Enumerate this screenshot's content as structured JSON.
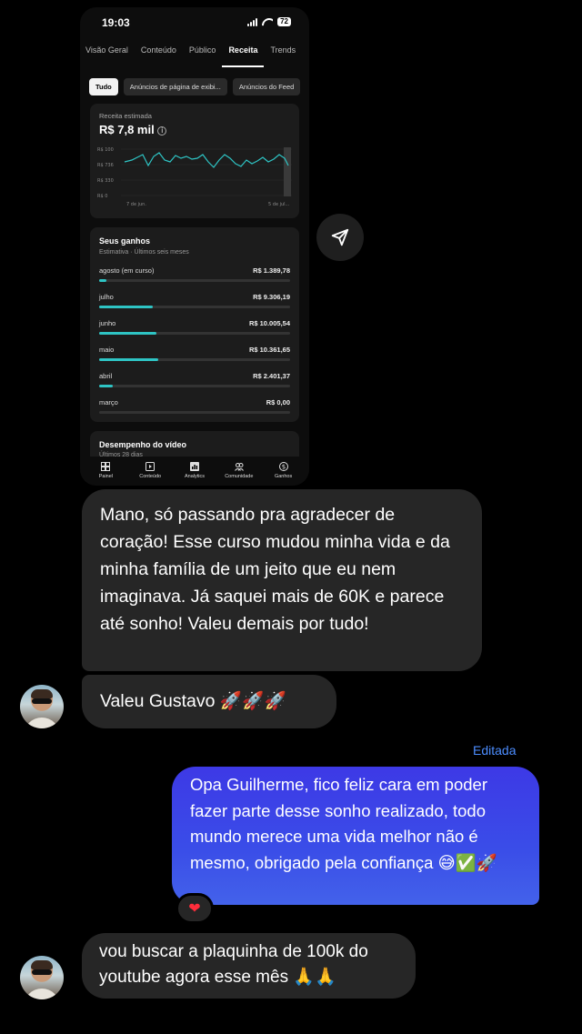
{
  "shared_screenshot": {
    "status_time": "19:03",
    "battery": "72",
    "tabs": [
      "Visão Geral",
      "Conteúdo",
      "Público",
      "Receita",
      "Trends"
    ],
    "active_tab": "Receita",
    "chips": [
      "Tudo",
      "Anúncios de página de exibi...",
      "Anúncios do Feed"
    ],
    "revenue_card": {
      "label": "Receita estimada",
      "value": "R$ 7,8 mil",
      "info_icon": "info-icon",
      "y_ticks": [
        "R$ 100",
        "R$ 736",
        "R$ 330",
        "R$ 0"
      ],
      "x_ticks": [
        "7 de jun.",
        "5 de jul..."
      ]
    },
    "earnings": {
      "title": "Seus ganhos",
      "subtitle": "Estimativa · Últimos seis meses",
      "rows": [
        {
          "month": "agosto (em curso)",
          "value": "R$ 1.389,78",
          "fraction": 0.04
        },
        {
          "month": "julho",
          "value": "R$ 9.306,19",
          "fraction": 0.28
        },
        {
          "month": "junho",
          "value": "R$ 10.005,54",
          "fraction": 0.3
        },
        {
          "month": "maio",
          "value": "R$ 10.361,65",
          "fraction": 0.31
        },
        {
          "month": "abril",
          "value": "R$ 2.401,37",
          "fraction": 0.07
        },
        {
          "month": "março",
          "value": "R$ 0,00",
          "fraction": 0
        }
      ]
    },
    "video_card": {
      "title": "Desempenho do vídeo",
      "subtitle": "Últimos 28 dias"
    },
    "bottom_nav": [
      "Painel",
      "Conteúdo",
      "Analytics",
      "Comunidade",
      "Ganhos"
    ]
  },
  "chat": {
    "message1": "Mano, só passando pra agradecer de coração! Esse curso mudou minha vida e da minha família de um jeito que eu nem imaginava. Já saquei mais de 60K e parece até sonho! Valeu demais por tudo!",
    "message2": "Valeu Gustavo 🚀🚀🚀",
    "edited_label": "Editada",
    "reply": "Opa Guilherme, fico feliz cara em poder fazer parte desse sonho realizado, todo mundo merece uma vida melhor não é mesmo, obrigado pela confiança 😅✅🚀",
    "reaction": "❤",
    "message3": "vou buscar a plaquinha de 100k do youtube agora esse mês 🙏🙏"
  },
  "colors": {
    "background": "#000000",
    "incoming_bubble": "#262626",
    "outgoing_bubble": "#3d39e6",
    "edited": "#4c8dff",
    "chart_line": "#2ec4c4"
  }
}
